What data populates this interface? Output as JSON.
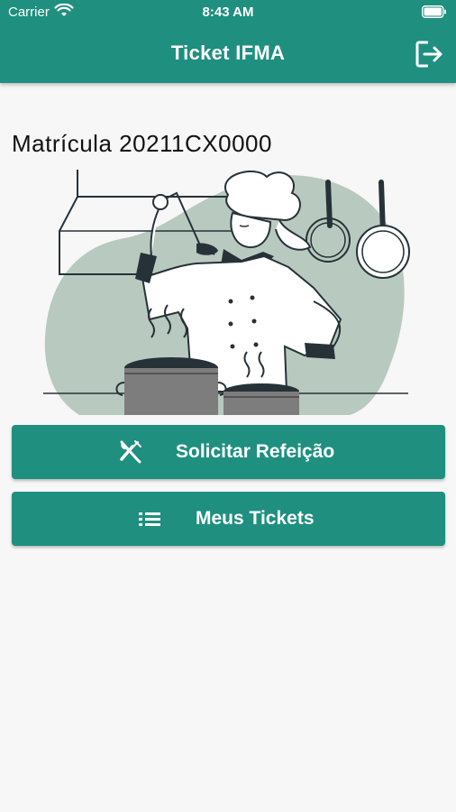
{
  "status_bar": {
    "carrier": "Carrier",
    "time": "8:43 AM"
  },
  "app_bar": {
    "title": "Ticket IFMA",
    "logout_icon": "logout-icon"
  },
  "main": {
    "matricula": "Matrícula 20211CX0000",
    "illustration": "chef-illustration"
  },
  "actions": [
    {
      "label": "Solicitar Refeição",
      "icon": "fork-knife-icon"
    },
    {
      "label": "Meus Tickets",
      "icon": "list-icon"
    }
  ],
  "colors": {
    "primary": "#1f8f80",
    "background": "#f7f7f7",
    "illustration_dark": "#263238",
    "illustration_green": "#b8c9bf"
  }
}
